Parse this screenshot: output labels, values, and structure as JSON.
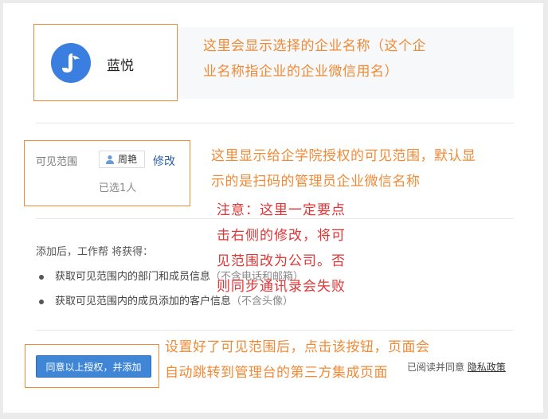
{
  "company": {
    "name": "蓝悦",
    "note_line1": "这里会显示选择的企业名称（这个企",
    "note_line2": "业名称指企业的企业微信用名）"
  },
  "visibility": {
    "label": "可见范围",
    "user_chip": "周艳",
    "edit_link": "修改",
    "selected_count": "已选1人",
    "note_line1": "这里显示给企学院授权的可见范围，默认显",
    "note_line2": "示的是扫码的管理员企业微信名称"
  },
  "warning": {
    "lines": [
      "注意：这里一定要点",
      "击右侧的修改，将可",
      "见范围改为公司。否",
      "则同步通讯录会失败"
    ]
  },
  "permissions": {
    "intro": "添加后，工作帮 将获得：",
    "items": [
      {
        "text": "获取可见范围内的部门和成员信息",
        "note": "（不含电话和邮箱）"
      },
      {
        "text": "获取可见范围内的成员添加的客户信息",
        "note": "（不含头像）"
      }
    ]
  },
  "footer": {
    "button_label": "同意以上授权，并添加",
    "note_line1": "设置好了可见范围后，点击该按钮，页面会",
    "note_line2": "自动跳转到管理台的第三方集成页面",
    "agree_text": "已阅读并同意",
    "privacy_link": "隐私政策"
  }
}
